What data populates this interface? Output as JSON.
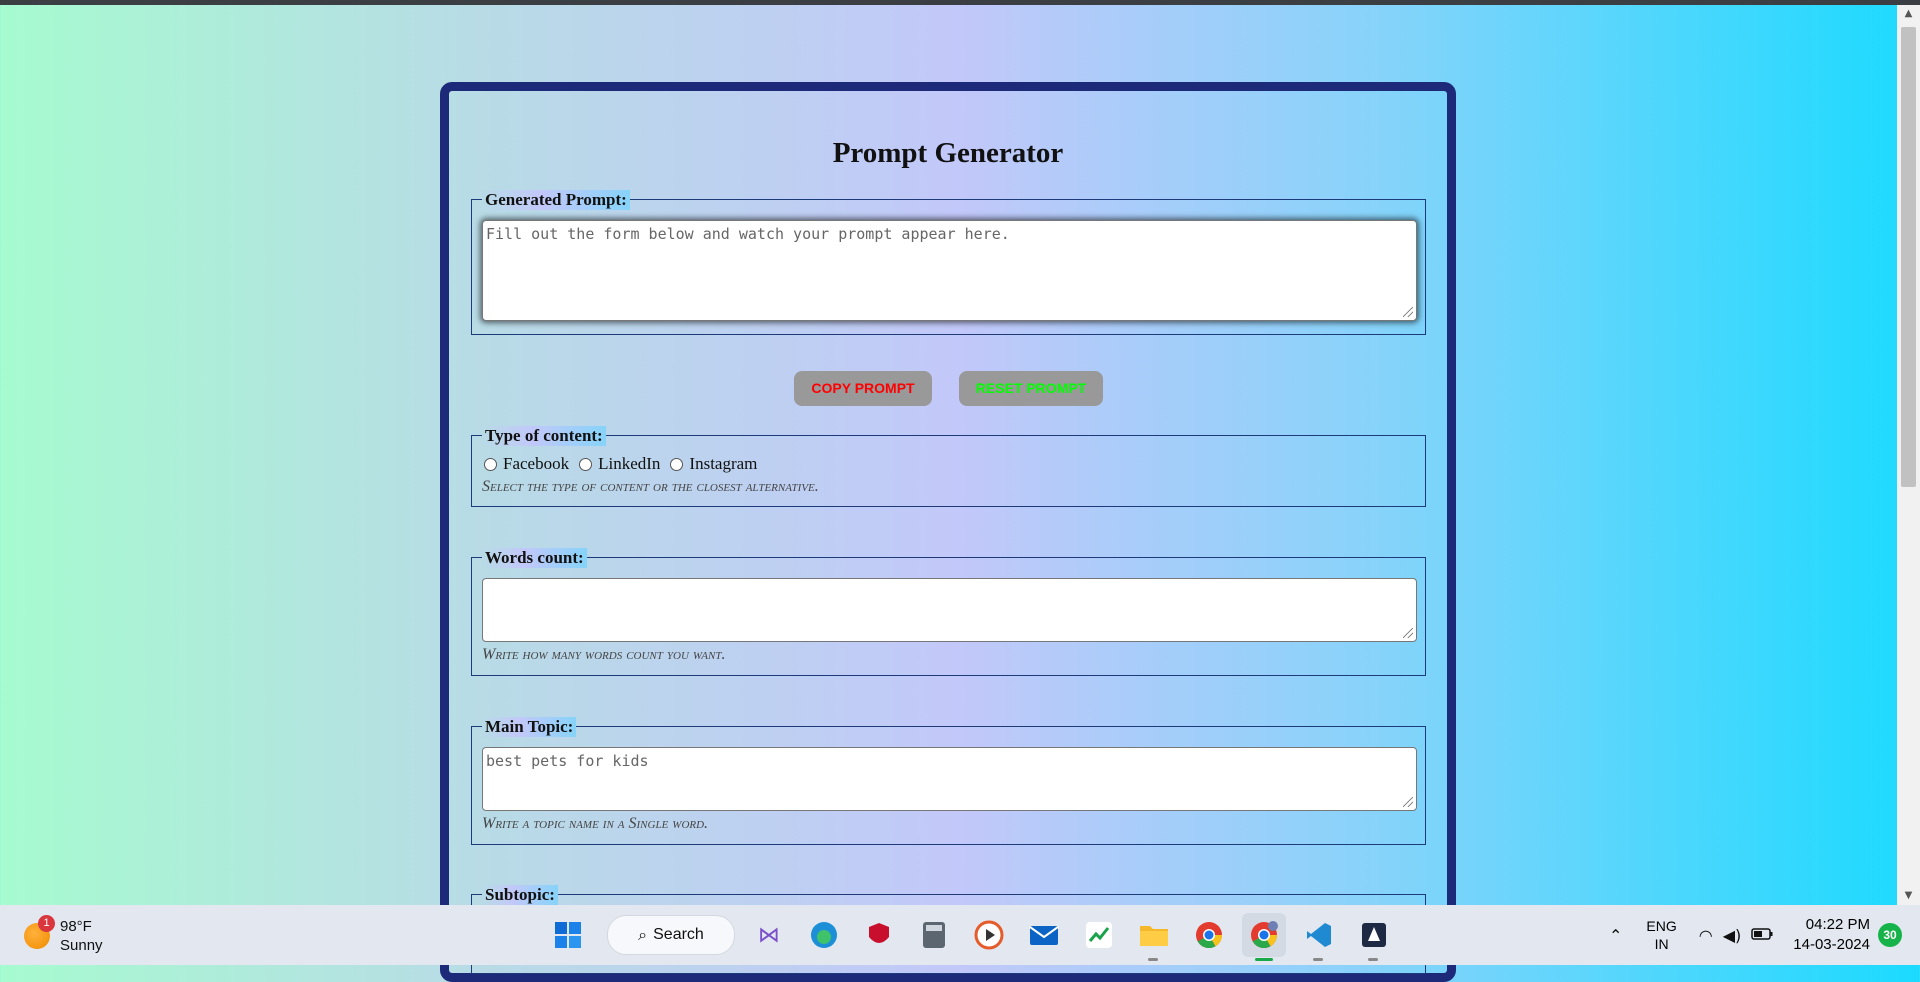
{
  "form": {
    "title": "Prompt Generator",
    "generated": {
      "legend": "Generated Prompt:",
      "placeholder": "Fill out the form below and watch your prompt appear here."
    },
    "copy_label": "COPY PROMPT",
    "reset_label": "RESET PROMPT",
    "content_type": {
      "legend": "Type of content:",
      "options": [
        "Facebook",
        "LinkedIn",
        "Instagram"
      ],
      "help": "Select the type of content or the closest alternative."
    },
    "words": {
      "legend": "Words count:",
      "placeholder": "",
      "help": "Write how many words count you want."
    },
    "topic": {
      "legend": "Main Topic:",
      "placeholder": "best pets for kids",
      "help": "Write a topic name in a Single word."
    },
    "subtopic": {
      "legend": "Subtopic:"
    }
  },
  "colors": {
    "copy_text": "#ff0000",
    "reset_text": "#00ff00",
    "card_border": "#1d2a7a"
  },
  "taskbar": {
    "weather": {
      "temp": "98°F",
      "condition": "Sunny",
      "badge": "1"
    },
    "search_label": "Search",
    "apps": [
      "visual-studio-icon",
      "edge-icon",
      "mcafee-icon",
      "calculator-icon",
      "media-player-icon",
      "mail-icon",
      "stocks-icon",
      "file-explorer-icon",
      "chrome-icon",
      "chrome-profile-icon",
      "vscode-icon",
      "app-icon"
    ],
    "tray": {
      "lang": "ENG",
      "region": "IN",
      "time": "04:22 PM",
      "date": "14-03-2024",
      "notifications": "30"
    }
  }
}
